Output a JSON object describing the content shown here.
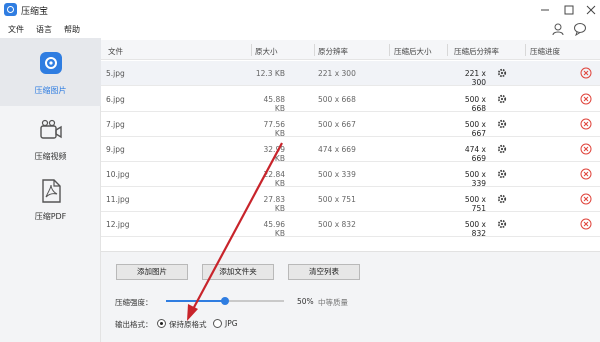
{
  "app": {
    "title": "压缩宝"
  },
  "menu": [
    "文件",
    "语言",
    "帮助"
  ],
  "sidebar": {
    "items": [
      {
        "label": "压缩图片",
        "icon": "image-compress-icon",
        "active": true
      },
      {
        "label": "压缩视频",
        "icon": "video-compress-icon",
        "active": false
      },
      {
        "label": "压缩PDF",
        "icon": "pdf-compress-icon",
        "active": false
      }
    ]
  },
  "table": {
    "columns": [
      "文件",
      "原大小",
      "原分辨率",
      "压缩后大小",
      "压缩后分辨率",
      "压缩进度"
    ],
    "rows": [
      {
        "name": "5.jpg",
        "size": "12.3 KB",
        "resolution": "221 x 300",
        "out_resolution": "221 x 300"
      },
      {
        "name": "6.jpg",
        "size": "45.88 KB",
        "resolution": "500 x 668",
        "out_resolution": "500 x 668"
      },
      {
        "name": "7.jpg",
        "size": "77.56 KB",
        "resolution": "500 x 667",
        "out_resolution": "500 x 667"
      },
      {
        "name": "9.jpg",
        "size": "32.99 KB",
        "resolution": "474 x 669",
        "out_resolution": "474 x 669"
      },
      {
        "name": "10.jpg",
        "size": "22.84 KB",
        "resolution": "500 x 339",
        "out_resolution": "500 x 339"
      },
      {
        "name": "11.jpg",
        "size": "27.83 KB",
        "resolution": "500 x 751",
        "out_resolution": "500 x 751"
      },
      {
        "name": "12.jpg",
        "size": "45.96 KB",
        "resolution": "500 x 832",
        "out_resolution": "500 x 832"
      }
    ]
  },
  "actions": {
    "add_image": "添加图片",
    "add_folder": "添加文件夹",
    "clear_list": "清空列表"
  },
  "compression": {
    "label": "压缩强度：",
    "value": "50%",
    "value_fraction": 0.5,
    "quality_text": "中等质量"
  },
  "output_format": {
    "label": "输出格式：",
    "options": [
      "保持原格式",
      "JPG"
    ],
    "selected": "保持原格式"
  },
  "colors": {
    "accent": "#2f7de1",
    "delete": "#e0433b",
    "arrow": "#c8242b"
  }
}
